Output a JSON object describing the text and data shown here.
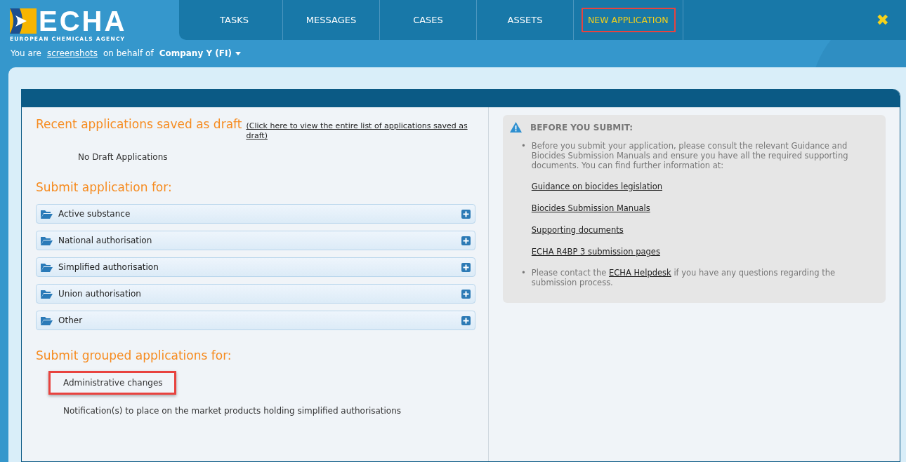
{
  "header": {
    "logo_text": "ECHA",
    "logo_subtitle": "EUROPEAN CHEMICALS AGENCY"
  },
  "tabs": [
    {
      "label": "TASKS",
      "selected": false,
      "highlighted": false
    },
    {
      "label": "MESSAGES",
      "selected": false,
      "highlighted": false
    },
    {
      "label": "CASES",
      "selected": false,
      "highlighted": false
    },
    {
      "label": "ASSETS",
      "selected": false,
      "highlighted": false
    },
    {
      "label": "NEW APPLICATION",
      "selected": true,
      "highlighted": true
    }
  ],
  "close_button": "✖",
  "user_bar": {
    "prefix": "You are",
    "user": "screenshots",
    "middle": "on behalf of",
    "company": "Company Y (FI)"
  },
  "drafts": {
    "title": "Recent applications saved as draft",
    "link": "(Click here to view the entire list of applications saved as draft)",
    "empty": "No Draft Applications"
  },
  "submit": {
    "title": "Submit application for:",
    "items": [
      {
        "label": "Active substance",
        "expanded": false
      },
      {
        "label": "National authorisation",
        "expanded": false
      },
      {
        "label": "Simplified authorisation",
        "expanded": false
      },
      {
        "label": "Union authorisation",
        "expanded": false
      },
      {
        "label": "Other",
        "expanded": false
      }
    ]
  },
  "grouped": {
    "title": "Submit grouped applications for:",
    "items": [
      {
        "label": "Administrative changes",
        "highlighted": true
      },
      {
        "label": "Notification(s) to place on the market products holding simplified authorisations",
        "highlighted": false
      }
    ]
  },
  "notice": {
    "title": "BEFORE YOU SUBMIT:",
    "bullet": "•",
    "intro": "Before you submit your application, please consult the relevant Guidance and Biocides Submission Manuals and ensure you have all the required supporting documents. You can find further information at:",
    "links": [
      "Guidance on biocides legislation",
      "Biocides Submission Manuals",
      "Supporting documents",
      "ECHA R4BP 3 submission pages"
    ],
    "contact_before": "Please contact the",
    "contact_link": "ECHA Helpdesk",
    "contact_after": "if you have any questions regarding the submission process."
  }
}
